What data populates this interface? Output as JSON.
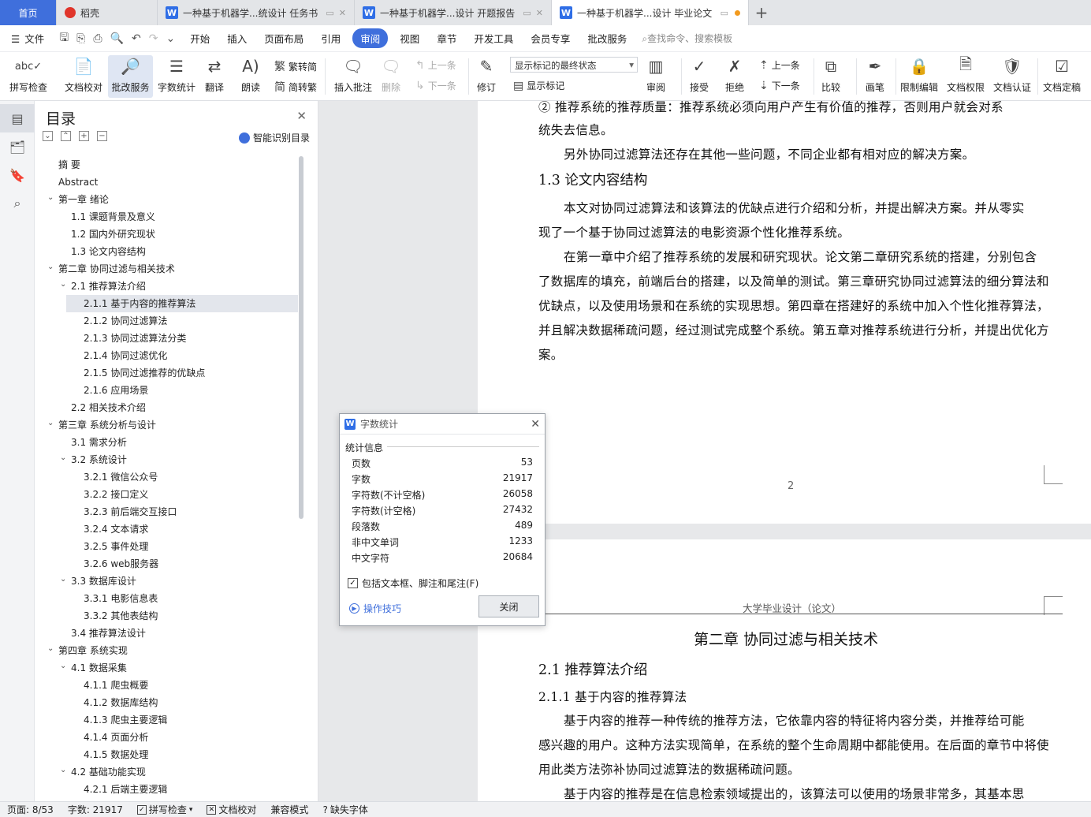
{
  "tabs": [
    {
      "label": "首页"
    },
    {
      "label": "稻壳"
    },
    {
      "label": "一种基于机器学...统设计 任务书"
    },
    {
      "label": "一种基于机器学...设计 开题报告"
    },
    {
      "label": "一种基于机器学...设计 毕业论文"
    }
  ],
  "menu": {
    "file": "文件",
    "items": [
      "开始",
      "插入",
      "页面布局",
      "引用",
      "审阅",
      "视图",
      "章节",
      "开发工具",
      "会员专享",
      "批改服务"
    ],
    "search": "查找命令、搜索模板"
  },
  "ribbon": {
    "spell": "拼写检查",
    "proof": "文档校对",
    "review_service": "批改服务",
    "wordcount": "字数统计",
    "translate": "翻译",
    "read": "朗读",
    "trad": "繁转简",
    "simp": "简转繁",
    "insert_comment": "插入批注",
    "delete": "删除",
    "prev": "上一条",
    "next": "下一条",
    "track": "修订",
    "mark_state": "显示标记的最终状态",
    "show_mark": "显示标记",
    "review": "审阅",
    "accept": "接受",
    "reject": "拒绝",
    "prev2": "上一条",
    "next2": "下一条",
    "compare": "比较",
    "pen": "画笔",
    "restrict": "限制编辑",
    "perm": "文档权限",
    "cert": "文档认证",
    "final": "文档定稿"
  },
  "toc": {
    "title": "目录",
    "smart": "智能识别目录",
    "items": [
      {
        "text": "摘  要"
      },
      {
        "text": "Abstract"
      },
      {
        "text": "第一章 绪论"
      },
      {
        "text": "1.1 课题背景及意义"
      },
      {
        "text": "1.2 国内外研究现状"
      },
      {
        "text": "1.3 论文内容结构"
      },
      {
        "text": "第二章 协同过滤与相关技术"
      },
      {
        "text": "2.1 推荐算法介绍"
      },
      {
        "text": "2.1.1 基于内容的推荐算法"
      },
      {
        "text": "2.1.2 协同过滤算法"
      },
      {
        "text": "2.1.3 协同过滤算法分类"
      },
      {
        "text": "2.1.4 协同过滤优化"
      },
      {
        "text": "2.1.5 协同过滤推荐的优缺点"
      },
      {
        "text": "2.1.6 应用场景"
      },
      {
        "text": "2.2 相关技术介绍"
      },
      {
        "text": "第三章 系统分析与设计"
      },
      {
        "text": "3.1 需求分析"
      },
      {
        "text": "3.2 系统设计"
      },
      {
        "text": "3.2.1 微信公众号"
      },
      {
        "text": "3.2.2 接口定义"
      },
      {
        "text": "3.2.3 前后端交互接口"
      },
      {
        "text": "3.2.4 文本请求"
      },
      {
        "text": "3.2.5 事件处理"
      },
      {
        "text": "3.2.6 web服务器"
      },
      {
        "text": "3.3 数据库设计"
      },
      {
        "text": "3.3.1 电影信息表"
      },
      {
        "text": "3.3.2 其他表结构"
      },
      {
        "text": "3.4 推荐算法设计"
      },
      {
        "text": "第四章 系统实现"
      },
      {
        "text": "4.1 数据采集"
      },
      {
        "text": "4.1.1 爬虫概要"
      },
      {
        "text": "4.1.2 数据库结构"
      },
      {
        "text": "4.1.3 爬虫主要逻辑"
      },
      {
        "text": "4.1.4 页面分析"
      },
      {
        "text": "4.1.5 数据处理"
      },
      {
        "text": "4.2 基础功能实现"
      },
      {
        "text": "4.2.1 后端主要逻辑"
      }
    ]
  },
  "doc": {
    "p1": [
      "②  推荐系统的推荐质量：推荐系统必须向用户产生有价值的推荐，否则用户就会对系",
      "统失去信息。",
      "另外协同过滤算法还存在其他一些问题，不同企业都有相对应的解决方案。"
    ],
    "h13": "1.3  论文内容结构",
    "p2": [
      "本文对协同过滤算法和该算法的优缺点进行介绍和分析，并提出解决方案。并从零实",
      "现了一个基于协同过滤算法的电影资源个性化推荐系统。",
      "在第一章中介绍了推荐系统的发展和研究现状。论文第二章研究系统的搭建，分别包含",
      "了数据库的填充，前端后台的搭建，以及简单的测试。第三章研究协同过滤算法的细分算法和",
      "优缺点，以及使用场景和在系统的实现思想。第四章在搭建好的系统中加入个性化推荐算法，",
      "并且解决数据稀疏问题，经过测试完成整个系统。第五章对推荐系统进行分析，并提出优化方",
      "案。"
    ],
    "pagenum": "2",
    "header": "大学毕业设计（论文）",
    "chapter": "第二章 协同过滤与相关技术",
    "h21": "2.1 推荐算法介绍",
    "h211": "2.1.1 基于内容的推荐算法",
    "p3": [
      "基于内容的推荐一种传统的推荐方法，它依靠内容的特征将内容分类，并推荐给可能",
      "感兴趣的用户。这种方法实现简单，在系统的整个生命周期中都能使用。在后面的章节中将使",
      "用此类方法弥补协同过滤算法的数据稀疏问题。",
      "基于内容的推荐是在信息检索领域提出的，该算法可以使用的场景非常多，其基本思"
    ]
  },
  "dialog": {
    "title": "字数统计",
    "section": "统计信息",
    "rows": [
      {
        "label": "页数",
        "value": "53"
      },
      {
        "label": "字数",
        "value": "21917"
      },
      {
        "label": "字符数(不计空格)",
        "value": "26058"
      },
      {
        "label": "字符数(计空格)",
        "value": "27432"
      },
      {
        "label": "段落数",
        "value": "489"
      },
      {
        "label": "非中文单词",
        "value": "1233"
      },
      {
        "label": "中文字符",
        "value": "20684"
      }
    ],
    "checkbox": "包括文本框、脚注和尾注(F)",
    "tips": "操作技巧",
    "close": "关闭"
  },
  "status": {
    "page": "页面: 8/53",
    "words": "字数: 21917",
    "spell": "拼写检查",
    "proof": "文档校对",
    "compat": "兼容模式",
    "font": "缺失字体"
  }
}
